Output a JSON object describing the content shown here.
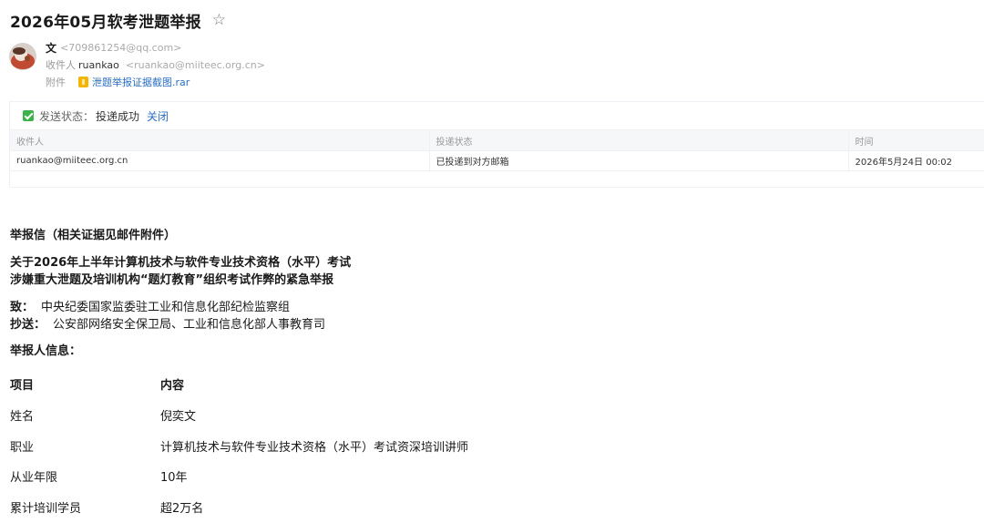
{
  "email": {
    "subject": "2026年05月软考泄题举报",
    "from": {
      "name": "文",
      "address": "<709861254@qq.com>"
    },
    "to": {
      "label": "收件人",
      "name": "ruankao",
      "address": "<ruankao@miiteec.org.cn>"
    },
    "attachment": {
      "label": "附件",
      "filename": "泄题举报证据截图.rar"
    }
  },
  "delivery": {
    "status_label": "发送状态：",
    "status_value": "投递成功",
    "close_label": "关闭",
    "columns": [
      "收件人",
      "投递状态",
      "时间"
    ],
    "rows": [
      {
        "recipient": "ruankao@miiteec.org.cn",
        "state": "已投递到对方邮箱",
        "time": "2026年5月24日 00:02"
      }
    ]
  },
  "body": {
    "letter_title": "举报信（相关证据见邮件附件）",
    "subject_line1": "关于2026年上半年计算机技术与软件专业技术资格（水平）考试",
    "subject_line2": "涉嫌重大泄题及培训机构“题灯教育”组织考试作弊的紧急举报",
    "to_key": "致：",
    "to_value": "中央纪委国家监委驻工业和信息化部纪检监察组",
    "cc_key": "抄送：",
    "cc_value": "公安部网络安全保卫局、工业和信息化部人事教育司",
    "reporter_heading": "举报人信息：",
    "table_header": {
      "item": "项目",
      "content": "内容"
    },
    "table_rows": [
      {
        "item": "姓名",
        "content": "倪奕文"
      },
      {
        "item": "职业",
        "content": "计算机技术与软件专业技术资格（水平）考试资深培训讲师"
      },
      {
        "item": "从业年限",
        "content": "10年"
      },
      {
        "item": "累计培训学员",
        "content": "超2万名"
      }
    ]
  }
}
